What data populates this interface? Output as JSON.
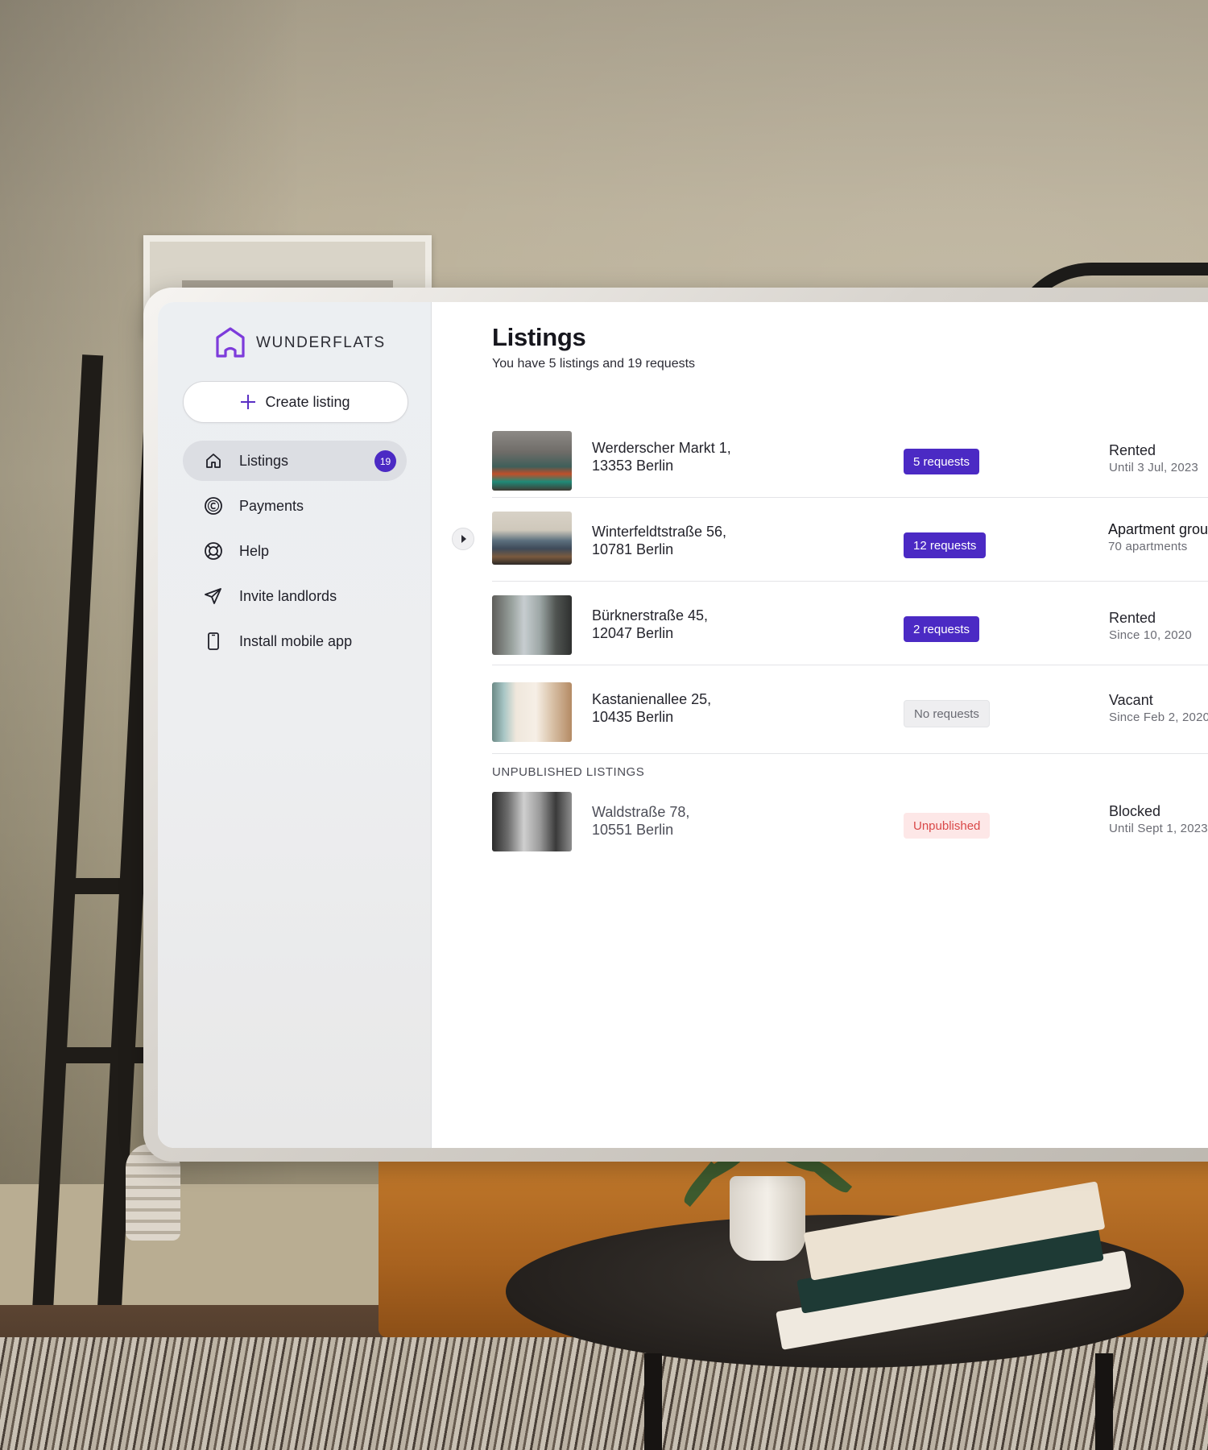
{
  "brand": {
    "name": "WUNDERFLATS",
    "accent": "#4b2ac4",
    "logo_color": "#7d3bdb"
  },
  "sidebar": {
    "create_label": "Create listing",
    "items": [
      {
        "label": "Listings",
        "icon": "home-icon",
        "badge": "19",
        "active": true
      },
      {
        "label": "Payments",
        "icon": "payments-icon"
      },
      {
        "label": "Help",
        "icon": "lifebuoy-icon"
      },
      {
        "label": "Invite landlords",
        "icon": "send-icon"
      },
      {
        "label": "Install mobile app",
        "icon": "phone-icon"
      }
    ]
  },
  "page": {
    "title": "Listings",
    "subtitle": "You have 5 listings and 19 requests",
    "unpublished_label": "UNPUBLISHED LISTINGS"
  },
  "listings": [
    {
      "address_line1": "Werderscher Markt 1,",
      "address_line2": "13353 Berlin",
      "tag": "5 requests",
      "tag_style": "purple",
      "status": "Rented",
      "status_sub": "Until 3 Jul, 2023"
    },
    {
      "address_line1": "Winterfeldtstraße 56,",
      "address_line2": "10781 Berlin",
      "tag": "12 requests",
      "tag_style": "purple",
      "status": "Apartment grou",
      "status_sub": "70 apartments",
      "expandable": true
    },
    {
      "address_line1": "Bürknerstraße 45,",
      "address_line2": "12047 Berlin",
      "tag": "2 requests",
      "tag_style": "purple",
      "status": "Rented",
      "status_sub": "Since  10, 2020"
    },
    {
      "address_line1": "Kastanienallee 25,",
      "address_line2": "10435 Berlin",
      "tag": "No requests",
      "tag_style": "grey",
      "status": "Vacant",
      "status_sub": "Since Feb 2, 2020"
    }
  ],
  "unpublished": [
    {
      "address_line1": "Waldstraße 78,",
      "address_line2": "10551 Berlin",
      "tag": "Unpublished",
      "tag_style": "red",
      "status": "Blocked",
      "status_sub": "Until Sept 1, 2023"
    }
  ]
}
